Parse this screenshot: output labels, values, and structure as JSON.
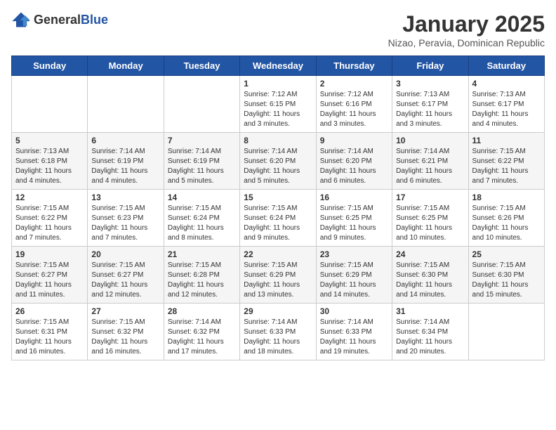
{
  "logo": {
    "general": "General",
    "blue": "Blue"
  },
  "title": "January 2025",
  "subtitle": "Nizao, Peravia, Dominican Republic",
  "days_of_week": [
    "Sunday",
    "Monday",
    "Tuesday",
    "Wednesday",
    "Thursday",
    "Friday",
    "Saturday"
  ],
  "weeks": [
    [
      {
        "day": "",
        "info": ""
      },
      {
        "day": "",
        "info": ""
      },
      {
        "day": "",
        "info": ""
      },
      {
        "day": "1",
        "info": "Sunrise: 7:12 AM\nSunset: 6:15 PM\nDaylight: 11 hours and 3 minutes."
      },
      {
        "day": "2",
        "info": "Sunrise: 7:12 AM\nSunset: 6:16 PM\nDaylight: 11 hours and 3 minutes."
      },
      {
        "day": "3",
        "info": "Sunrise: 7:13 AM\nSunset: 6:17 PM\nDaylight: 11 hours and 3 minutes."
      },
      {
        "day": "4",
        "info": "Sunrise: 7:13 AM\nSunset: 6:17 PM\nDaylight: 11 hours and 4 minutes."
      }
    ],
    [
      {
        "day": "5",
        "info": "Sunrise: 7:13 AM\nSunset: 6:18 PM\nDaylight: 11 hours and 4 minutes."
      },
      {
        "day": "6",
        "info": "Sunrise: 7:14 AM\nSunset: 6:19 PM\nDaylight: 11 hours and 4 minutes."
      },
      {
        "day": "7",
        "info": "Sunrise: 7:14 AM\nSunset: 6:19 PM\nDaylight: 11 hours and 5 minutes."
      },
      {
        "day": "8",
        "info": "Sunrise: 7:14 AM\nSunset: 6:20 PM\nDaylight: 11 hours and 5 minutes."
      },
      {
        "day": "9",
        "info": "Sunrise: 7:14 AM\nSunset: 6:20 PM\nDaylight: 11 hours and 6 minutes."
      },
      {
        "day": "10",
        "info": "Sunrise: 7:14 AM\nSunset: 6:21 PM\nDaylight: 11 hours and 6 minutes."
      },
      {
        "day": "11",
        "info": "Sunrise: 7:15 AM\nSunset: 6:22 PM\nDaylight: 11 hours and 7 minutes."
      }
    ],
    [
      {
        "day": "12",
        "info": "Sunrise: 7:15 AM\nSunset: 6:22 PM\nDaylight: 11 hours and 7 minutes."
      },
      {
        "day": "13",
        "info": "Sunrise: 7:15 AM\nSunset: 6:23 PM\nDaylight: 11 hours and 7 minutes."
      },
      {
        "day": "14",
        "info": "Sunrise: 7:15 AM\nSunset: 6:24 PM\nDaylight: 11 hours and 8 minutes."
      },
      {
        "day": "15",
        "info": "Sunrise: 7:15 AM\nSunset: 6:24 PM\nDaylight: 11 hours and 9 minutes."
      },
      {
        "day": "16",
        "info": "Sunrise: 7:15 AM\nSunset: 6:25 PM\nDaylight: 11 hours and 9 minutes."
      },
      {
        "day": "17",
        "info": "Sunrise: 7:15 AM\nSunset: 6:25 PM\nDaylight: 11 hours and 10 minutes."
      },
      {
        "day": "18",
        "info": "Sunrise: 7:15 AM\nSunset: 6:26 PM\nDaylight: 11 hours and 10 minutes."
      }
    ],
    [
      {
        "day": "19",
        "info": "Sunrise: 7:15 AM\nSunset: 6:27 PM\nDaylight: 11 hours and 11 minutes."
      },
      {
        "day": "20",
        "info": "Sunrise: 7:15 AM\nSunset: 6:27 PM\nDaylight: 11 hours and 12 minutes."
      },
      {
        "day": "21",
        "info": "Sunrise: 7:15 AM\nSunset: 6:28 PM\nDaylight: 11 hours and 12 minutes."
      },
      {
        "day": "22",
        "info": "Sunrise: 7:15 AM\nSunset: 6:29 PM\nDaylight: 11 hours and 13 minutes."
      },
      {
        "day": "23",
        "info": "Sunrise: 7:15 AM\nSunset: 6:29 PM\nDaylight: 11 hours and 14 minutes."
      },
      {
        "day": "24",
        "info": "Sunrise: 7:15 AM\nSunset: 6:30 PM\nDaylight: 11 hours and 14 minutes."
      },
      {
        "day": "25",
        "info": "Sunrise: 7:15 AM\nSunset: 6:30 PM\nDaylight: 11 hours and 15 minutes."
      }
    ],
    [
      {
        "day": "26",
        "info": "Sunrise: 7:15 AM\nSunset: 6:31 PM\nDaylight: 11 hours and 16 minutes."
      },
      {
        "day": "27",
        "info": "Sunrise: 7:15 AM\nSunset: 6:32 PM\nDaylight: 11 hours and 16 minutes."
      },
      {
        "day": "28",
        "info": "Sunrise: 7:14 AM\nSunset: 6:32 PM\nDaylight: 11 hours and 17 minutes."
      },
      {
        "day": "29",
        "info": "Sunrise: 7:14 AM\nSunset: 6:33 PM\nDaylight: 11 hours and 18 minutes."
      },
      {
        "day": "30",
        "info": "Sunrise: 7:14 AM\nSunset: 6:33 PM\nDaylight: 11 hours and 19 minutes."
      },
      {
        "day": "31",
        "info": "Sunrise: 7:14 AM\nSunset: 6:34 PM\nDaylight: 11 hours and 20 minutes."
      },
      {
        "day": "",
        "info": ""
      }
    ]
  ]
}
